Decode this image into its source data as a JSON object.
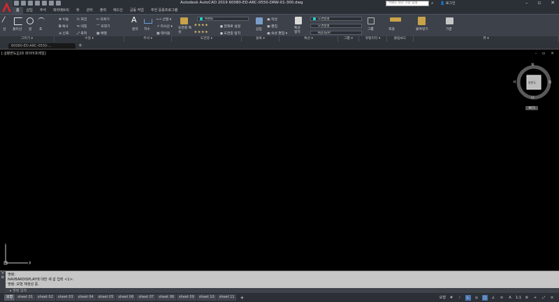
{
  "window": {
    "title": "Autodesk AutoCAD 2019    60080-ED-ARC-0550-DRW-01-300.dwg",
    "search_placeholder": "키워드 또는 구문 입력",
    "user_label": "로그인"
  },
  "ribbon_tabs": [
    "홈",
    "삽입",
    "주석",
    "파라메트릭",
    "뷰",
    "관리",
    "출력",
    "애드인",
    "공동 작업",
    "추천 응용프로그램"
  ],
  "ribbon": {
    "draw": {
      "line": "선",
      "polyline": "폴리선",
      "circle": "원",
      "arc": "호"
    },
    "modify": {
      "move": "이동",
      "rotate": "회전",
      "trim": "자르기",
      "copy": "복사",
      "mirror": "대칭",
      "fillet": "모깎기",
      "stretch": "신축",
      "scale": "축척",
      "array": "배열"
    },
    "annotation": {
      "text": "문자",
      "dimension": "치수",
      "linear": "선형",
      "leader": "지시선",
      "table": "테이블"
    },
    "layers": {
      "properties": "도면층 특성",
      "current_layer": "A00G",
      "make_current": "현재로 설정",
      "match": "도면층 일치"
    },
    "block": {
      "insert": "삽입",
      "create": "작성",
      "edit": "편집",
      "edit_attr": "속성 편집"
    },
    "properties": {
      "match": "특성 일치",
      "color": "도면층별",
      "linetype": "도면층별",
      "lineweight": "ByLayer"
    },
    "groups": {
      "group": "그룹"
    },
    "utilities": {
      "measure": "측정"
    },
    "clipboard": {
      "paste": "붙여넣기"
    },
    "view": {
      "base": "기준"
    }
  },
  "panel_labels": [
    "그리기 ▾",
    "수정 ▾",
    "주석 ▾",
    "도면층 ▾",
    "블록 ▾",
    "특성 ▾",
    "그룹 ▾",
    "유틸리티 ▾",
    "클립보드",
    "뷰 ▾"
  ],
  "file_tab": {
    "name": "60080-ED-ARC-0550-..."
  },
  "viewport": {
    "label": "[-][평면도][2D 와이어프레임]",
    "viewcube": {
      "top": "북",
      "bottom": "남",
      "left": "서",
      "right": "동",
      "face": "평면도"
    },
    "wcs": "WCS"
  },
  "command": {
    "history": [
      "명령:",
      "NAVBARDISPLAY에 대한 새 값 입력 <1>:",
      "명령: 모형 재생성 중."
    ],
    "input_placeholder": "명령 입력"
  },
  "layout_tabs": [
    "모형",
    "sheet 01",
    "sheet 02",
    "sheet 03",
    "sheet 04",
    "sheet 05",
    "sheet 06",
    "sheet 07",
    "sheet 08",
    "sheet 09",
    "sheet 10",
    "sheet 11"
  ],
  "statusbar": {
    "mode": "모형",
    "scale": "1:1"
  }
}
